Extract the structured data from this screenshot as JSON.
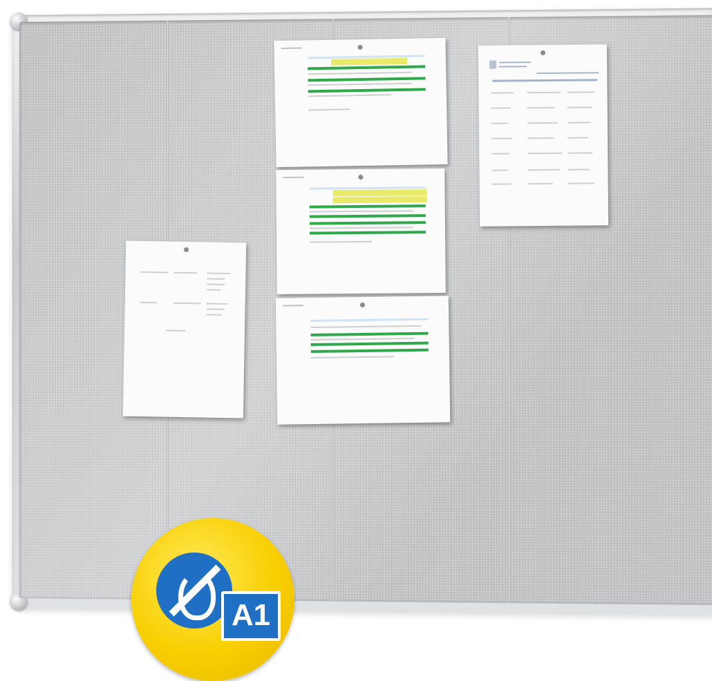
{
  "product": {
    "kind": "pinboard",
    "frame_color": "#c9cdd0",
    "panel_color": "#bdbfc1",
    "badge": {
      "label": "A1",
      "icon": "no-fire-icon",
      "background_color": "#f8cf00",
      "icon_color": "#1f6fc4"
    }
  }
}
